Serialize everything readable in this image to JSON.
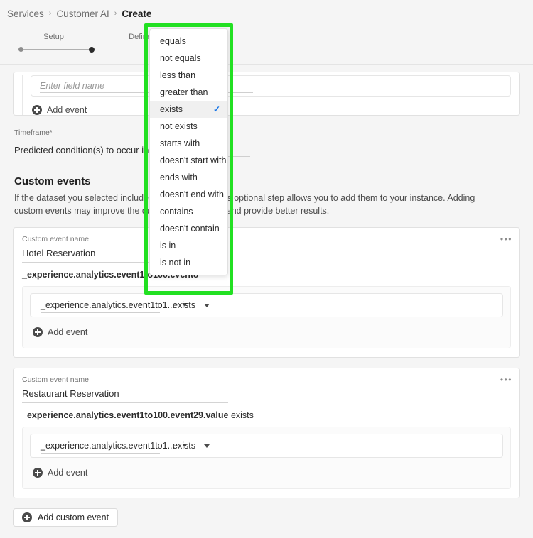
{
  "breadcrumb": {
    "items": [
      {
        "label": "Services",
        "current": false
      },
      {
        "label": "Customer AI",
        "current": false
      },
      {
        "label": "Create",
        "current": true
      }
    ],
    "separator": "›"
  },
  "stepper": {
    "steps": [
      {
        "label": "Setup",
        "state": "done"
      },
      {
        "label": "Define goal",
        "state": "active"
      }
    ]
  },
  "goal_card": {
    "field_placeholder": "Enter field name",
    "add_event_label": "Add event"
  },
  "timeframe": {
    "label": "Timeframe*",
    "prefix_text": "Predicted condition(s) to occur in next",
    "value": "",
    "spinner_up": "▲",
    "spinner_down": "▼"
  },
  "custom_events": {
    "heading": "Custom events",
    "description": "If the dataset you selected includes custom events, this optional step allows you to add them to your instance. Adding custom events may improve the quality of your model and provide better results.",
    "name_label": "Custom event name",
    "more_icon": "•••",
    "add_event_label": "Add event",
    "add_custom_event_label": "Add custom event",
    "cards": [
      {
        "name": "Hotel Reservation",
        "summary_field": "_experience.analytics.event1to100.event8",
        "summary_operator": "",
        "rule": {
          "field": "_experience.analytics.event1to1...",
          "operator": "exists"
        }
      },
      {
        "name": "Restaurant Reservation",
        "summary_field": "_experience.analytics.event1to100.event29.value",
        "summary_operator": "exists",
        "rule": {
          "field": "_experience.analytics.event1to1...",
          "operator": "exists"
        }
      }
    ]
  },
  "operator_dropdown": {
    "selected": "exists",
    "check_glyph": "✓",
    "options": [
      "equals",
      "not equals",
      "less than",
      "greater than",
      "exists",
      "not exists",
      "starts with",
      "doesn't start with",
      "ends with",
      "doesn't end with",
      "contains",
      "doesn't contain",
      "is in",
      "is not in"
    ]
  },
  "colors": {
    "highlight": "#22e022",
    "checkmark": "#1473e6",
    "page_bg": "#f5f5f5"
  }
}
